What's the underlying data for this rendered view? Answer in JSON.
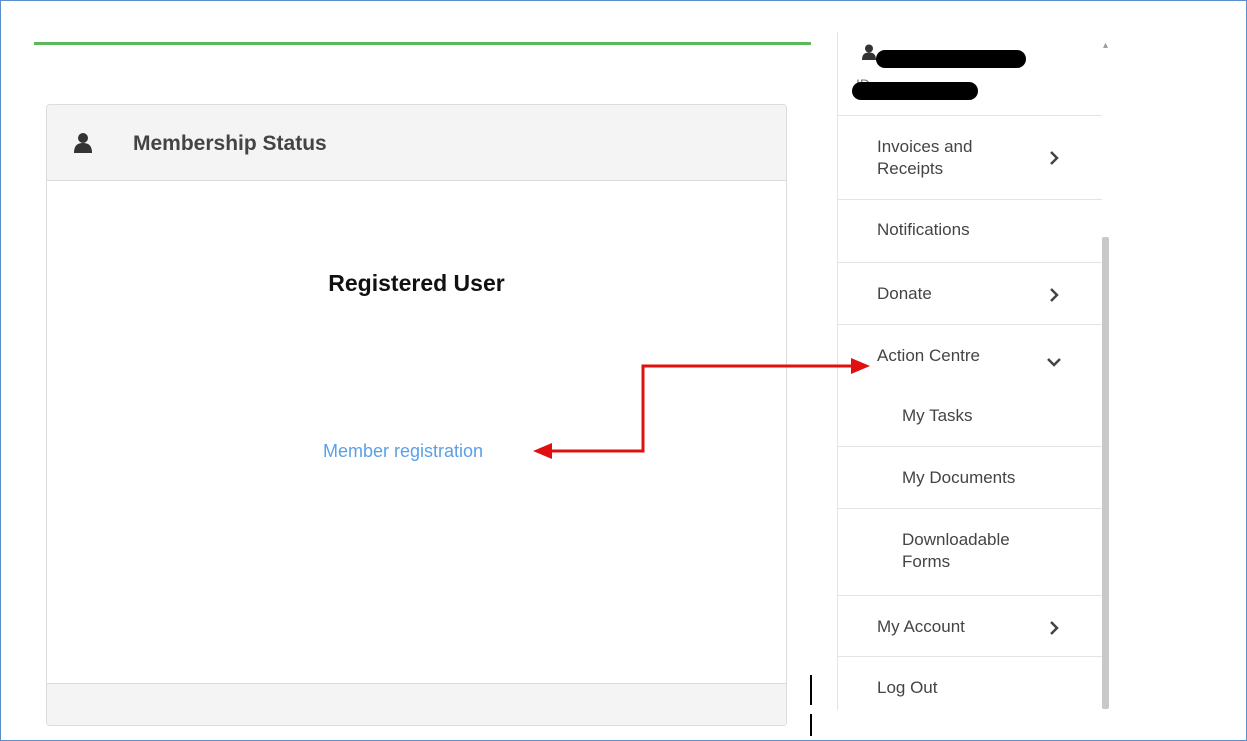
{
  "card": {
    "title": "Membership Status",
    "status": "Registered User",
    "link_label": "Member registration"
  },
  "sidebar": {
    "profile_id_fragment": "ID",
    "items": [
      {
        "label": "Invoices and Receipts",
        "icon": "chevron-right-icon"
      },
      {
        "label": "Notifications"
      },
      {
        "label": "Donate",
        "icon": "chevron-right-icon"
      },
      {
        "label": "Action Centre",
        "icon": "chevron-down-icon"
      },
      {
        "label": "My Tasks"
      },
      {
        "label": "My Documents"
      },
      {
        "label": "Downloadable Forms"
      },
      {
        "label": "My Account",
        "icon": "chevron-right-icon"
      },
      {
        "label": "Log Out"
      }
    ]
  },
  "colors": {
    "accent_green": "#5cb85c",
    "link_blue": "#5aa0e6",
    "annotation_red": "#e01010"
  }
}
